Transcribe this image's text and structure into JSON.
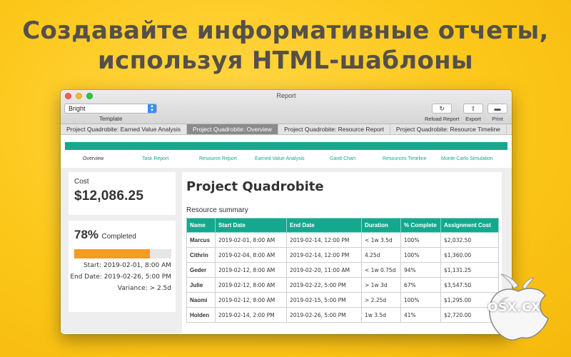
{
  "headline": {
    "line1": "Создавайте информативные отчеты,",
    "line2": "используя HTML-шаблоны"
  },
  "window": {
    "title": "Report",
    "template_select_value": "Bright",
    "template_label": "Template",
    "toolbar": {
      "reload_label": "Reload Report",
      "export_label": "Export",
      "print_label": "Print",
      "reload_icon": "reload-icon",
      "export_icon": "share-icon",
      "print_icon": "printer-icon"
    },
    "tabs": [
      {
        "label": "Project Quadrobite: Earned Value Analysis"
      },
      {
        "label": "Project Quadrobite: Overview"
      },
      {
        "label": "Project Quadrobite: Resource Report"
      },
      {
        "label": "Project Quadrobite: Resource Timeline"
      }
    ],
    "active_tab": 1
  },
  "report": {
    "accent_color": "#14a98f",
    "progress_color": "#f49b22",
    "subnav": [
      "Overview",
      "Task Report",
      "Resource Report",
      "Earned Value Analysis",
      "Gantt Chart",
      "Resources Timeline",
      "Monte Carlo Simulation"
    ],
    "cost": {
      "label": "Cost",
      "value": "$12,086.25"
    },
    "progress": {
      "percent_text": "78%",
      "completed_word": "Completed",
      "fraction": 0.78,
      "start": "Start: 2019-02-01, 8:00 AM",
      "end": "End Date: 2019-02-26, 5:00 PM",
      "variance": "Variance: > 2.5d"
    },
    "title": "Project Quadrobite",
    "resource_summary": {
      "label": "Resource summary",
      "headers": [
        "Name",
        "Start Date",
        "End Date",
        "Duration",
        "% Complete",
        "Assignment Cost"
      ],
      "rows": [
        [
          "Marcus",
          "2019-02-01, 8:00 AM",
          "2019-02-14, 12:00 PM",
          "< 1w 3.5d",
          "100%",
          "$2,032.50"
        ],
        [
          "Cithrin",
          "2019-02-04, 8:00 AM",
          "2019-02-14, 12:00 PM",
          "4.25d",
          "100%",
          "$1,360.00"
        ],
        [
          "Geder",
          "2019-02-12, 8:00 AM",
          "2019-02-20, 11:00 AM",
          "< 1w 0.75d",
          "94%",
          "$1,131.25"
        ],
        [
          "Julie",
          "2019-02-12, 8:00 AM",
          "2019-02-22, 5:00 PM",
          "> 1w 3d",
          "67%",
          "$3,547.50"
        ],
        [
          "Naomi",
          "2019-02-12, 8:00 AM",
          "2019-02-15, 5:00 PM",
          "> 2.25d",
          "100%",
          "$1,295.00"
        ],
        [
          "Holden",
          "2019-02-14, 2:00 PM",
          "2019-02-26, 5:00 PM",
          "1w 3.5d",
          "41%",
          "$2,720.00"
        ]
      ]
    }
  },
  "watermark": {
    "text": "OSX.CX",
    "icon": "apple-logo-icon"
  }
}
